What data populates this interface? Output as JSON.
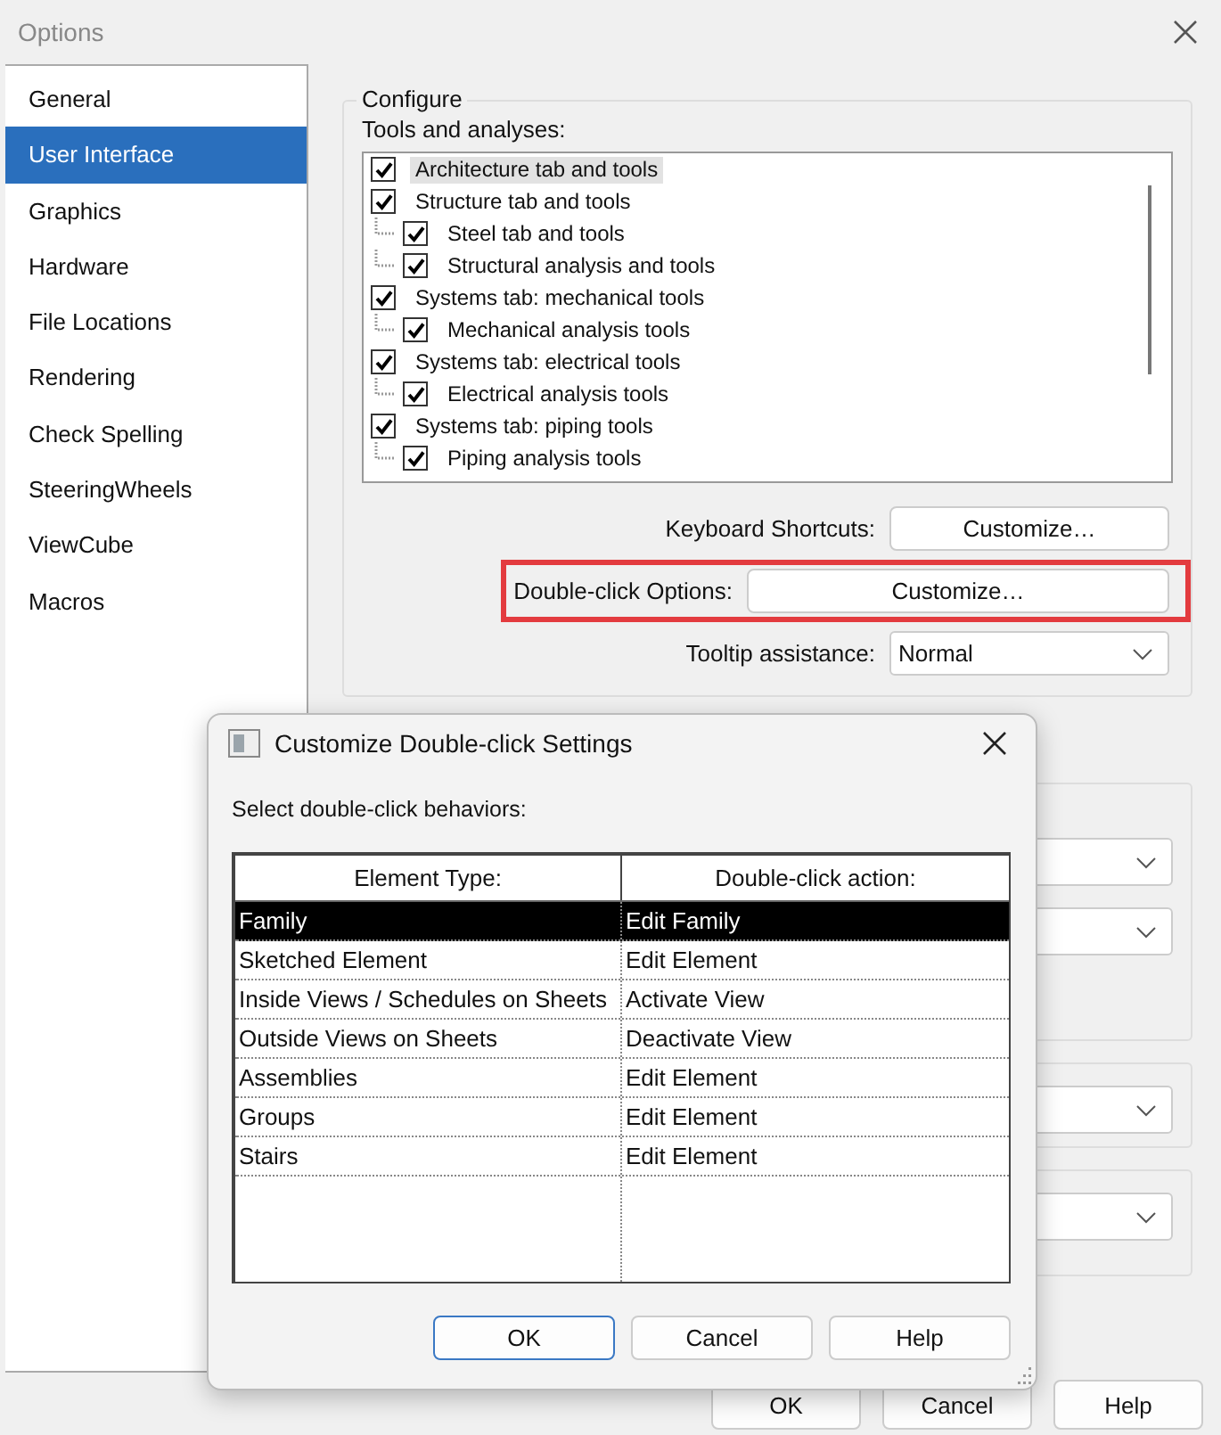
{
  "window": {
    "title": "Options"
  },
  "sidebar": {
    "items": [
      {
        "label": "General",
        "selected": false
      },
      {
        "label": "User Interface",
        "selected": true
      },
      {
        "label": "Graphics",
        "selected": false
      },
      {
        "label": "Hardware",
        "selected": false
      },
      {
        "label": "File Locations",
        "selected": false
      },
      {
        "label": "Rendering",
        "selected": false
      },
      {
        "label": "Check Spelling",
        "selected": false
      },
      {
        "label": "SteeringWheels",
        "selected": false
      },
      {
        "label": "ViewCube",
        "selected": false
      },
      {
        "label": "Macros",
        "selected": false
      }
    ]
  },
  "configure": {
    "title": "Configure",
    "tools_label": "Tools and analyses:",
    "tools": [
      {
        "label": "Architecture tab and tools",
        "checked": true,
        "selected": true
      },
      {
        "label": "Structure tab and tools",
        "checked": true,
        "selected": false,
        "children": [
          {
            "label": "Steel tab and tools",
            "checked": true,
            "selected": false
          },
          {
            "label": "Structural analysis and tools",
            "checked": true,
            "selected": false
          }
        ]
      },
      {
        "label": "Systems tab: mechanical tools",
        "checked": true,
        "selected": false,
        "children": [
          {
            "label": "Mechanical analysis tools",
            "checked": true,
            "selected": false
          }
        ]
      },
      {
        "label": "Systems tab: electrical tools",
        "checked": true,
        "selected": false,
        "children": [
          {
            "label": "Electrical analysis tools",
            "checked": true,
            "selected": false
          }
        ]
      },
      {
        "label": "Systems tab: piping tools",
        "checked": true,
        "selected": false,
        "children": [
          {
            "label": "Piping analysis tools",
            "checked": true,
            "selected": false
          }
        ]
      }
    ],
    "settings": [
      {
        "label": "Keyboard Shortcuts:",
        "kind": "button",
        "value": "Customize…",
        "highlighted": false
      },
      {
        "label": "Double-click Options:",
        "kind": "button",
        "value": "Customize…",
        "highlighted": true
      },
      {
        "label": "Tooltip assistance:",
        "kind": "dropdown",
        "value": "Normal",
        "highlighted": false
      }
    ]
  },
  "footer_buttons": [
    {
      "label": "OK"
    },
    {
      "label": "Cancel"
    },
    {
      "label": "Help"
    }
  ],
  "dialog": {
    "title": "Customize Double-click Settings",
    "prompt": "Select double-click behaviors:",
    "columns": [
      "Element Type:",
      "Double-click action:"
    ],
    "rows": [
      {
        "cells": [
          "Family",
          "Edit Family"
        ],
        "selected": true
      },
      {
        "cells": [
          "Sketched Element",
          "Edit Element"
        ],
        "selected": false
      },
      {
        "cells": [
          "Inside Views / Schedules on Sheets",
          "Activate View"
        ],
        "selected": false
      },
      {
        "cells": [
          "Outside Views on Sheets",
          "Deactivate View"
        ],
        "selected": false
      },
      {
        "cells": [
          "Assemblies",
          "Edit Element"
        ],
        "selected": false
      },
      {
        "cells": [
          "Groups",
          "Edit Element"
        ],
        "selected": false
      },
      {
        "cells": [
          "Stairs",
          "Edit Element"
        ],
        "selected": false
      }
    ],
    "buttons": [
      {
        "label": "OK",
        "default": true
      },
      {
        "label": "Cancel",
        "default": false
      },
      {
        "label": "Help",
        "default": false
      }
    ]
  }
}
